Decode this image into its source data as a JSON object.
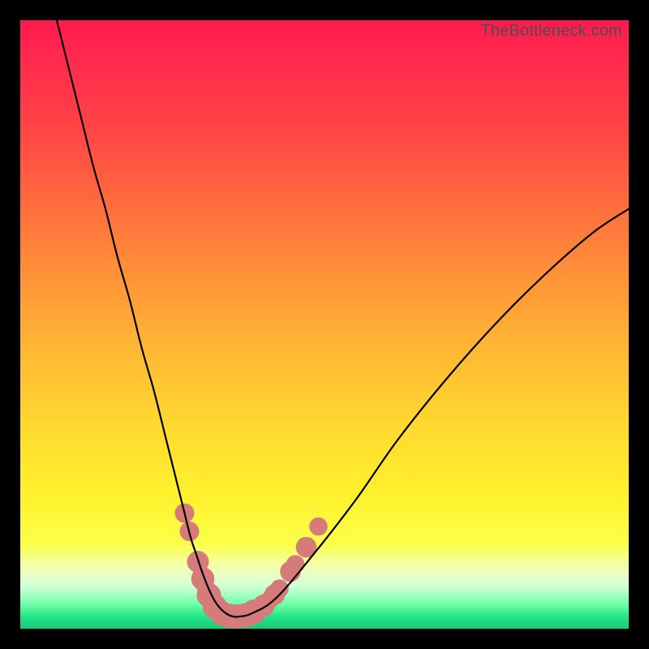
{
  "watermark": "TheBottleneck.com",
  "colors": {
    "background": "#000000",
    "bead": "#d77a7a",
    "curve": "#000000"
  },
  "chart_data": {
    "type": "line",
    "title": "",
    "xlabel": "",
    "ylabel": "",
    "xlim": [
      0,
      100
    ],
    "ylim": [
      0,
      100
    ],
    "series": [
      {
        "name": "bottleneck-curve",
        "x": [
          6,
          8,
          10,
          12,
          14,
          16,
          18,
          20,
          22,
          24,
          26,
          27,
          28,
          29,
          30,
          31,
          32,
          33,
          34,
          35,
          36,
          38,
          42,
          48,
          55,
          62,
          70,
          78,
          86,
          94,
          100
        ],
        "y": [
          100,
          92,
          84,
          76,
          69,
          61,
          54,
          46,
          39,
          31,
          23,
          19,
          15,
          12,
          9,
          6.5,
          4.5,
          3.2,
          2.4,
          2.0,
          2.0,
          2.5,
          5,
          12,
          21,
          31,
          41,
          50,
          58,
          65,
          69
        ]
      }
    ],
    "beads": {
      "comment": "salmon beads strung along the curve near its minimum",
      "points": [
        {
          "x": 27.0,
          "y": 19.0,
          "r": 1.6
        },
        {
          "x": 27.8,
          "y": 16.0,
          "r": 1.6
        },
        {
          "x": 29.2,
          "y": 11.0,
          "r": 1.8
        },
        {
          "x": 30.0,
          "y": 8.2,
          "r": 1.9
        },
        {
          "x": 31.0,
          "y": 5.5,
          "r": 2.0
        },
        {
          "x": 32.0,
          "y": 3.6,
          "r": 2.0
        },
        {
          "x": 33.2,
          "y": 2.5,
          "r": 2.0
        },
        {
          "x": 34.4,
          "y": 2.1,
          "r": 2.0
        },
        {
          "x": 35.6,
          "y": 2.0,
          "r": 2.0
        },
        {
          "x": 37.0,
          "y": 2.2,
          "r": 2.0
        },
        {
          "x": 38.4,
          "y": 2.8,
          "r": 2.0
        },
        {
          "x": 40.0,
          "y": 3.8,
          "r": 1.8
        },
        {
          "x": 41.8,
          "y": 5.6,
          "r": 1.7
        },
        {
          "x": 42.6,
          "y": 6.6,
          "r": 1.5
        },
        {
          "x": 44.4,
          "y": 9.4,
          "r": 1.7
        },
        {
          "x": 45.2,
          "y": 10.6,
          "r": 1.5
        },
        {
          "x": 47.0,
          "y": 13.4,
          "r": 1.7
        },
        {
          "x": 49.0,
          "y": 16.8,
          "r": 1.5
        }
      ],
      "string_from": 3,
      "string_to": 12
    }
  }
}
